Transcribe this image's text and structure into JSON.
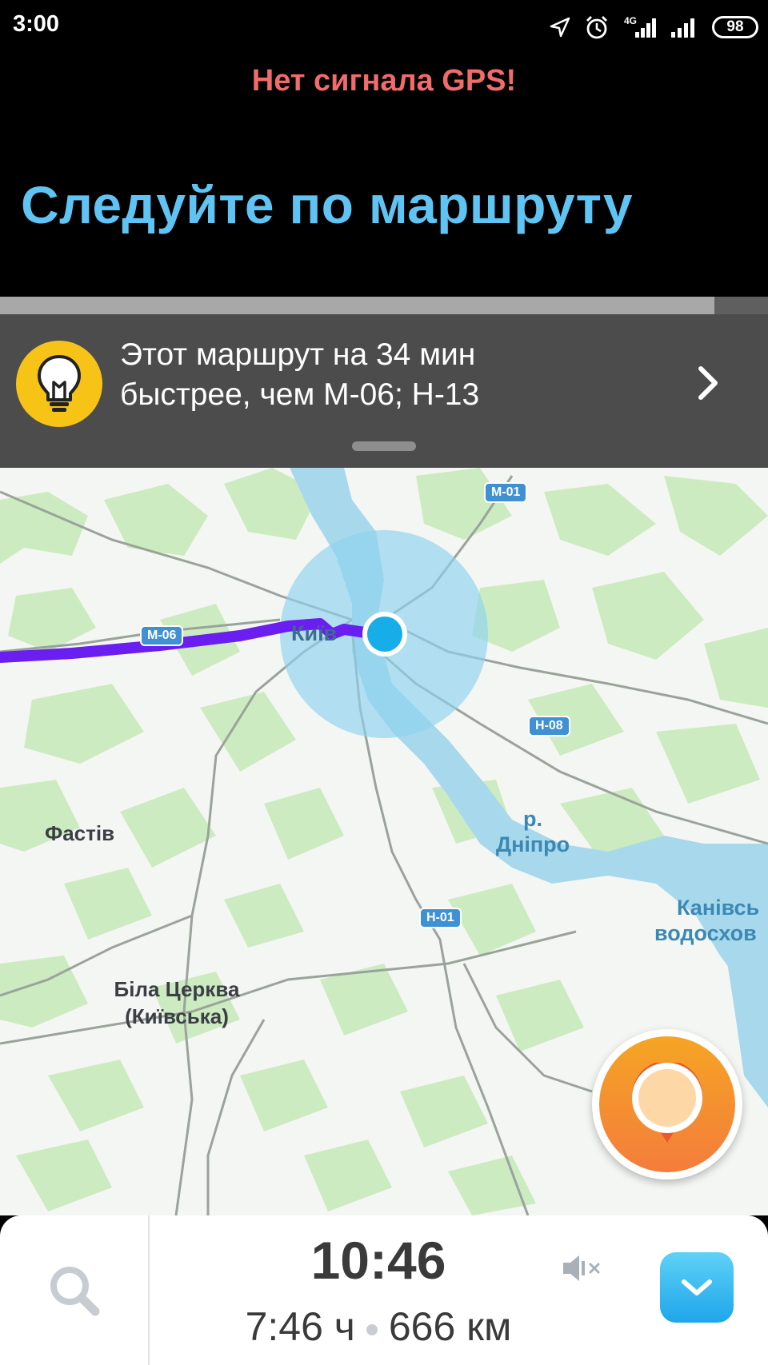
{
  "status_bar": {
    "time": "3:00",
    "network": "4G",
    "battery": "98",
    "icons": [
      "location-arrow-icon",
      "alarm-icon",
      "signal-4g-icon",
      "signal-icon",
      "battery-icon"
    ]
  },
  "header": {
    "gps_warning": "Нет сигнала GPS!",
    "instruction": "Следуйте по маршруту"
  },
  "progress": {
    "fraction": 0.93
  },
  "tip": {
    "line1": "Этот маршрут на 34 мин",
    "line2": "быстрее, чем М-06; Н-13",
    "icon": "lightbulb-icon"
  },
  "map": {
    "road_labels": [
      "M-01",
      "M-06",
      "H-08",
      "H-01"
    ],
    "cities": {
      "kyiv": "Київ",
      "fastiv": "Фастів",
      "bila_tserkva_line1": "Біла Церква",
      "bila_tserkva_line2": "(Київська)"
    },
    "water": {
      "dnipro_line1": "р.",
      "dnipro_line2": "Дніпро",
      "kaniv_line1": "Канівсь",
      "kaniv_line2": "водосхов"
    }
  },
  "bottom_bar": {
    "eta": "10:46",
    "duration": "7:46 ч",
    "distance": "666 км"
  },
  "colors": {
    "gps_warning": "#f26b6b",
    "instruction": "#5fc3f3",
    "route": "#6a1ef0",
    "accent": "#1ea6ea",
    "report": "#f47c3c"
  }
}
